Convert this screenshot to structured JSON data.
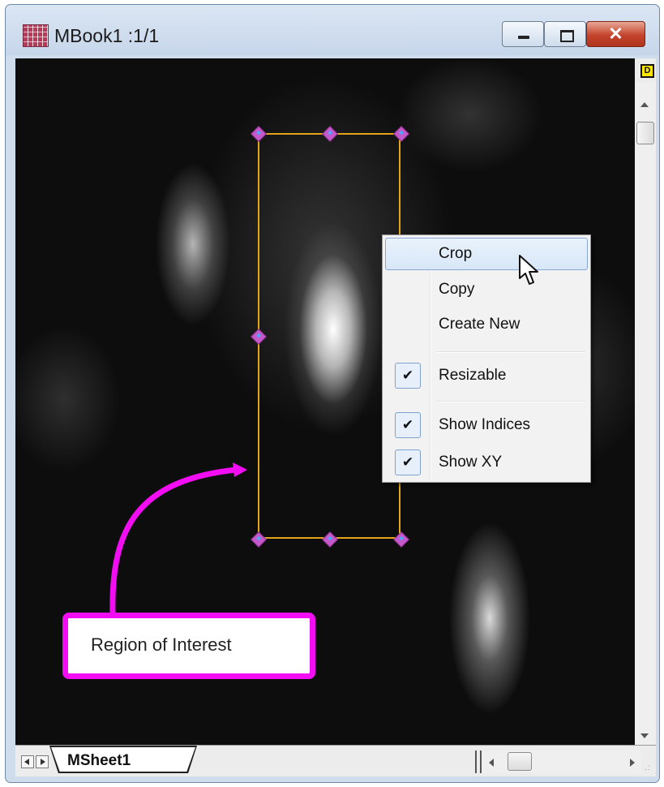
{
  "window": {
    "title": "MBook1 :1/1",
    "minimize_glyph": "",
    "maximize_glyph": "",
    "close_glyph": "✕"
  },
  "image": {
    "badge": "D"
  },
  "context_menu": {
    "items": [
      {
        "label": "Crop",
        "checked": false,
        "highlighted": true
      },
      {
        "label": "Copy",
        "checked": false
      },
      {
        "label": "Create New",
        "checked": false
      },
      {
        "label": "Resizable",
        "checked": true
      },
      {
        "label": "Show Indices",
        "checked": true
      },
      {
        "label": "Show XY",
        "checked": true
      }
    ],
    "check_glyph": "✔"
  },
  "annotation": {
    "callout_text": "Region of Interest",
    "color": "#f20df2"
  },
  "sheet_tabs": {
    "active": "MSheet1"
  },
  "colors": {
    "roi_border": "#e2a51a",
    "handle": "#c659c9",
    "menu_highlight": "#d7e7f8",
    "close_button": "#c3442c"
  }
}
